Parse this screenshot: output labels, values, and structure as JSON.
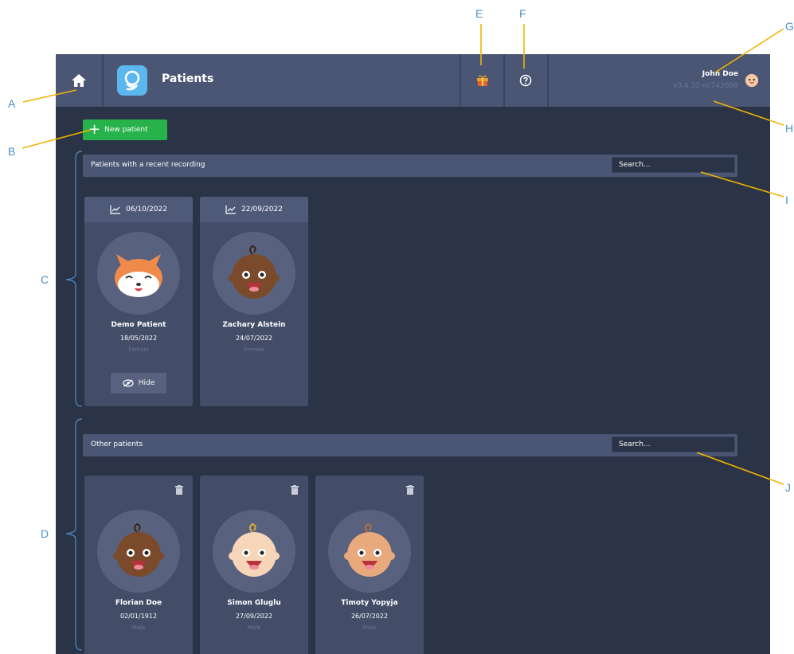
{
  "annotations": [
    "A",
    "B",
    "C",
    "D",
    "E",
    "F",
    "G",
    "H",
    "I",
    "J"
  ],
  "topbar": {
    "title": "Patients",
    "user_name": "John Doe",
    "version": "v0.4.32-ec742688",
    "icons": [
      "home-icon",
      "app-logo-icon",
      "gift-icon",
      "help-icon",
      "baby-avatar-icon"
    ]
  },
  "new_patient_label": "New patient",
  "recent": {
    "title": "Patients with a recent recording",
    "search_placeholder": "Search...",
    "patients": [
      {
        "recording_date": "06/10/2022",
        "name": "Demo Patient",
        "birth": "18/05/2022",
        "sex": "Female",
        "avatar": "fox",
        "action": "Hide"
      },
      {
        "recording_date": "22/09/2022",
        "name": "Zachary Alstein",
        "birth": "24/07/2022",
        "sex": "Female",
        "avatar": "baby-dark"
      }
    ]
  },
  "other": {
    "title": "Other patients",
    "search_placeholder": "Search...",
    "patients": [
      {
        "name": "Florian Doe",
        "birth": "02/01/1912",
        "sex": "Male",
        "avatar": "baby-dark"
      },
      {
        "name": "Simon Gluglu",
        "birth": "27/09/2022",
        "sex": "Male",
        "avatar": "baby-light"
      },
      {
        "name": "Timoty Yopyja",
        "birth": "26/07/2022",
        "sex": "Male",
        "avatar": "baby-medium"
      }
    ]
  },
  "colors": {
    "background": "#2b3346",
    "panel": "#4b5674",
    "card": "#434d68",
    "accent_green": "#27b24b",
    "annotation": "#4a90c8",
    "leader_line": "#f0b400"
  }
}
